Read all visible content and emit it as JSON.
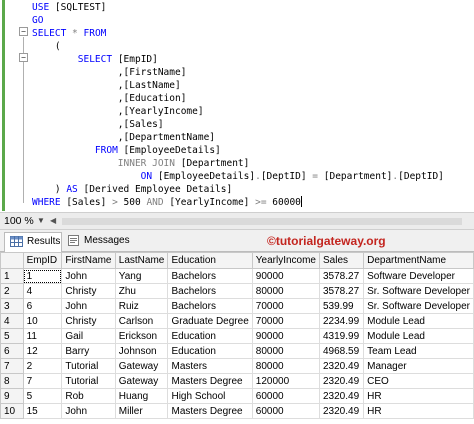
{
  "editor": {
    "lines": [
      [
        {
          "t": "USE ",
          "c": "kw"
        },
        {
          "t": "[SQLTEST]"
        }
      ],
      [
        {
          "t": "GO",
          "c": "kw"
        }
      ],
      [
        {
          "t": "SELECT",
          "c": "kw"
        },
        {
          "t": " * ",
          "c": "gr"
        },
        {
          "t": "FROM",
          "c": "kw"
        }
      ],
      [
        {
          "t": "    ("
        }
      ],
      [
        {
          "t": "        "
        },
        {
          "t": "SELECT ",
          "c": "kw"
        },
        {
          "t": "[EmpID]"
        }
      ],
      [
        {
          "t": "               ,[FirstName]"
        }
      ],
      [
        {
          "t": "               ,[LastName]"
        }
      ],
      [
        {
          "t": "               ,[Education]"
        }
      ],
      [
        {
          "t": "               ,[YearlyIncome]"
        }
      ],
      [
        {
          "t": "               ,[Sales]"
        }
      ],
      [
        {
          "t": "               ,[DepartmentName]"
        }
      ],
      [
        {
          "t": "           "
        },
        {
          "t": "FROM ",
          "c": "kw"
        },
        {
          "t": "[EmployeeDetails]"
        }
      ],
      [
        {
          "t": "               "
        },
        {
          "t": "INNER JOIN ",
          "c": "gr"
        },
        {
          "t": "[Department]"
        }
      ],
      [
        {
          "t": "                   "
        },
        {
          "t": "ON ",
          "c": "kw"
        },
        {
          "t": "[EmployeeDetails]"
        },
        {
          "t": ".",
          "c": "gr"
        },
        {
          "t": "[DeptID] "
        },
        {
          "t": "=",
          "c": "gr"
        },
        {
          "t": " [Department]"
        },
        {
          "t": ".",
          "c": "gr"
        },
        {
          "t": "[DeptID]"
        }
      ],
      [
        {
          "t": "    ) "
        },
        {
          "t": "AS ",
          "c": "kw"
        },
        {
          "t": "[Derived Employee Details]"
        }
      ],
      [
        {
          "t": "WHERE ",
          "c": "kw"
        },
        {
          "t": "[Sales] "
        },
        {
          "t": ">",
          "c": "gr"
        },
        {
          "t": " 500 "
        },
        {
          "t": "AND ",
          "c": "gr"
        },
        {
          "t": "[YearlyIncome] "
        },
        {
          "t": ">=",
          "c": "gr"
        },
        {
          "t": " 60000"
        }
      ]
    ]
  },
  "status": {
    "zoom": "100 %"
  },
  "tabs": {
    "results": "Results",
    "messages": "Messages"
  },
  "brand": "©tutorialgateway.org",
  "grid": {
    "columns": [
      "EmpID",
      "FirstName",
      "LastName",
      "Education",
      "YearlyIncome",
      "Sales",
      "DepartmentName"
    ],
    "rows": [
      [
        "1",
        "John",
        "Yang",
        "Bachelors",
        "90000",
        "3578.27",
        "Software Developer"
      ],
      [
        "4",
        "Christy",
        "Zhu",
        "Bachelors",
        "80000",
        "3578.27",
        "Sr. Software Developer"
      ],
      [
        "6",
        "John",
        "Ruiz",
        "Bachelors",
        "70000",
        "539.99",
        "Sr. Software Developer"
      ],
      [
        "10",
        "Christy",
        "Carlson",
        "Graduate Degree",
        "70000",
        "2234.99",
        "Module Lead"
      ],
      [
        "11",
        "Gail",
        "Erickson",
        "Education",
        "90000",
        "4319.99",
        "Module Lead"
      ],
      [
        "12",
        "Barry",
        "Johnson",
        "Education",
        "80000",
        "4968.59",
        "Team Lead"
      ],
      [
        "2",
        "Tutorial",
        "Gateway",
        "Masters",
        "80000",
        "2320.49",
        "Manager"
      ],
      [
        "7",
        "Tutorial",
        "Gateway",
        "Masters Degree",
        "120000",
        "2320.49",
        "CEO"
      ],
      [
        "5",
        "Rob",
        "Huang",
        "High School",
        "60000",
        "2320.49",
        "HR"
      ],
      [
        "15",
        "John",
        "Miller",
        "Masters Degree",
        "60000",
        "2320.49",
        "HR"
      ]
    ]
  }
}
